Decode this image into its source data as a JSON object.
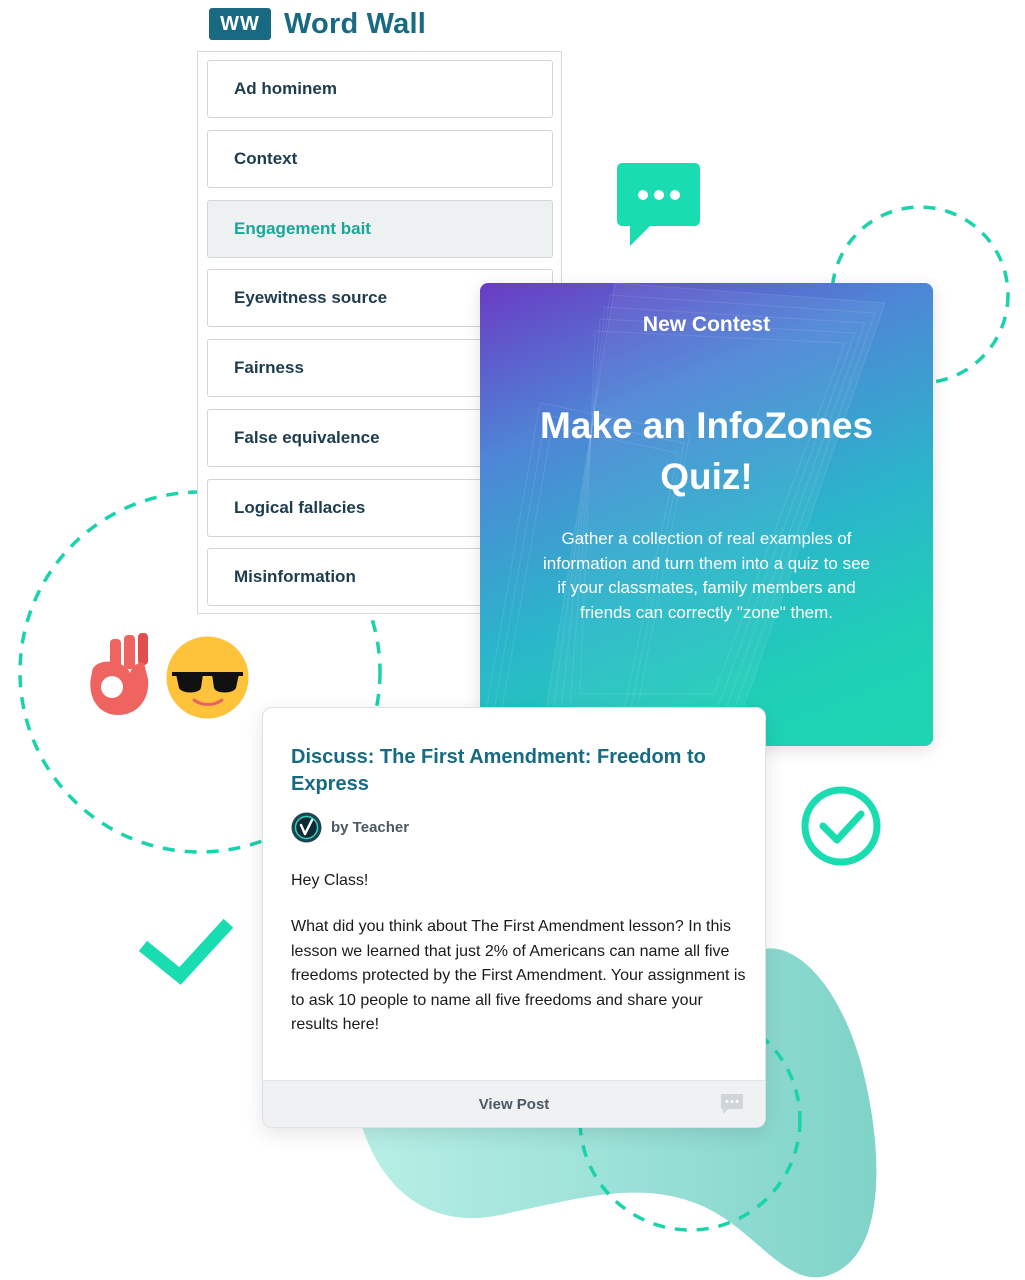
{
  "word_wall": {
    "logo": "WW",
    "title": "Word Wall",
    "items": [
      {
        "label": "Ad hominem"
      },
      {
        "label": "Context"
      },
      {
        "label": "Engagement bait"
      },
      {
        "label": "Eyewitness source"
      },
      {
        "label": "Fairness"
      },
      {
        "label": "False equivalence"
      },
      {
        "label": "Logical fallacies"
      },
      {
        "label": "Misinformation"
      }
    ],
    "active_item": "Engagement bait"
  },
  "contest": {
    "label": "New Contest",
    "title": "Make an InfoZones Quiz!",
    "description": "Gather a collection of real examples of information and turn them into a quiz to see if your classmates, family members and friends can correctly \"zone\" them."
  },
  "discussion": {
    "title": "Discuss: The First Amendment: Freedom to Express",
    "author": "by Teacher",
    "greeting": "Hey Class!",
    "body": "What did you think about The First Amendment lesson? In this lesson we learned that just 2% of Americans can name all five freedoms protected by the First Amendment. Your assignment is to ask 10 people to name all five freedoms and share your results here!",
    "view_post_label": "View Post"
  },
  "icons": {
    "speech_bubble": "speech-bubble-icon",
    "ok_hand": "ok-hand-emoji",
    "sunglasses_face": "sunglasses-face-emoji",
    "check": "check-icon",
    "check_circle": "check-circle-icon",
    "comment": "comment-icon",
    "author_avatar": "teacher-avatar-icon"
  },
  "colors": {
    "brand_teal": "#176a82",
    "accent_green": "#19dcb0",
    "active_text": "#1aa79a",
    "blob": "#8fdcd2",
    "gradient_start": "#6a3bc4",
    "gradient_end": "#1dd5b2"
  }
}
